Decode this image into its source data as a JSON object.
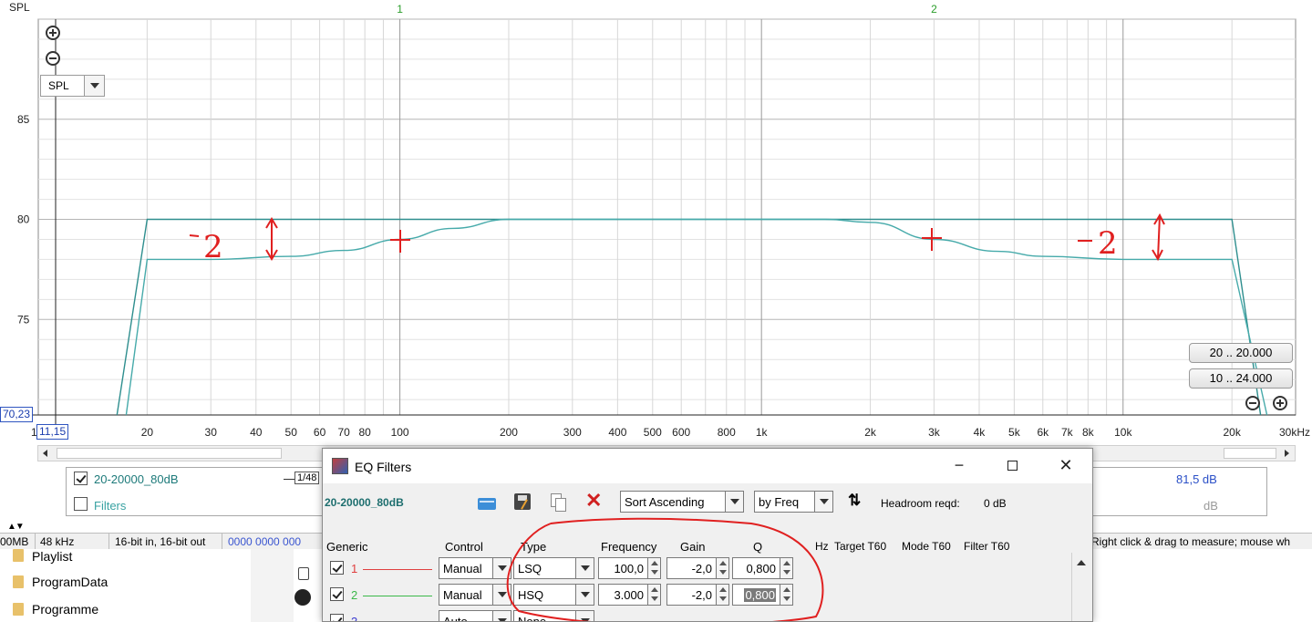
{
  "graph": {
    "y_axis_title": "SPL",
    "y_ticks": [
      "85",
      "80",
      "75"
    ],
    "cursor_value": "70,23",
    "x_cursor_value": "11,15",
    "x_ticks": [
      "1",
      "20",
      "30",
      "40",
      "50",
      "60",
      "70",
      "80",
      "100",
      "200",
      "300",
      "400",
      "500",
      "600",
      "800",
      "1k",
      "2k",
      "3k",
      "4k",
      "5k",
      "6k",
      "7k",
      "8k",
      "10k",
      "20k",
      "30kHz"
    ],
    "top_markers": [
      "1",
      "2"
    ],
    "spl_dropdown": "SPL",
    "range_buttons": [
      "20 .. 20.000",
      "10 .. 24.000"
    ],
    "annotations": [
      "-2",
      "-2"
    ],
    "colors": {
      "curve": "#3b9a9a",
      "grid": "#d7d7d7",
      "annotation": "#e02020",
      "marker": "#2a9d2a"
    }
  },
  "chart_data": {
    "type": "line",
    "title": "",
    "xlabel": "",
    "ylabel": "SPL",
    "x_scale": "log",
    "xlim": [
      10,
      30000
    ],
    "ylim": [
      70.23,
      90
    ],
    "series": [
      {
        "name": "20-20000_80dB",
        "x": [
          16.5,
          20,
          20000,
          24000
        ],
        "y": [
          70.23,
          80,
          80,
          70.23
        ]
      },
      {
        "name": "Filters",
        "x": [
          17.5,
          20,
          30,
          50,
          70,
          100,
          140,
          200,
          500,
          1000,
          1500,
          2000,
          3000,
          4500,
          6000,
          10000,
          20000,
          25000
        ],
        "y": [
          70.23,
          78,
          78,
          78.15,
          78.45,
          79,
          79.55,
          80,
          80,
          80,
          80,
          79.85,
          79,
          78.4,
          78.15,
          78,
          78,
          70.23
        ]
      }
    ]
  },
  "legend": {
    "rows": [
      {
        "name": "20-20000_80dB",
        "value": "81,5 dB"
      },
      {
        "name": "Filters",
        "value": "dB"
      }
    ],
    "smoothing_label": "1/48"
  },
  "statusbar": {
    "memory": "00MB",
    "rate": "48 kHz",
    "bits": "16-bit in, 16-bit out",
    "hex": "0000 0000 000",
    "hint": "Right click & drag to measure; mouse wh"
  },
  "explorer": {
    "items": [
      "Playlist",
      "ProgramData",
      "Programme"
    ]
  },
  "dialog": {
    "title": "EQ Filters",
    "measurement": "20-20000_80dB",
    "sort": "Sort Ascending",
    "sort_by": "by Freq",
    "headroom_label": "Headroom reqd:",
    "headroom_value": "0 dB",
    "columns": [
      "Generic",
      "Control",
      "Type",
      "Frequency",
      "Gain",
      "Q",
      "Hz",
      "Target T60",
      "Mode T60",
      "Filter T60"
    ],
    "filters": [
      {
        "index": "1",
        "control": "Manual",
        "type": "LSQ",
        "frequency": "100,0",
        "gain": "-2,0",
        "q": "0,800",
        "color": "#e04040"
      },
      {
        "index": "2",
        "control": "Manual",
        "type": "HSQ",
        "frequency": "3.000",
        "gain": "-2,0",
        "q": "0,800",
        "color": "#3cb84a"
      },
      {
        "index": "3",
        "control": "Auto",
        "type": "None",
        "frequency": "",
        "gain": "",
        "q": "",
        "color": "#3a3ad0"
      }
    ]
  }
}
